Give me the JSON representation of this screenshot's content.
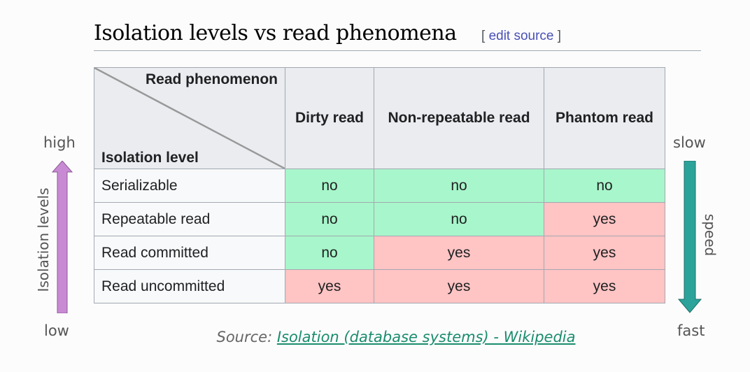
{
  "heading": {
    "title": "Isolation levels vs read phenomena",
    "edit_open": "[ ",
    "edit_link": "edit source",
    "edit_close": " ]"
  },
  "table": {
    "corner_top": "Read phenomenon",
    "corner_bottom": "Isolation level",
    "columns": [
      "Dirty read",
      "Non-repeatable read",
      "Phantom read"
    ],
    "rows": [
      {
        "label": "Serializable",
        "cells": [
          "no",
          "no",
          "no"
        ]
      },
      {
        "label": "Repeatable read",
        "cells": [
          "no",
          "no",
          "yes"
        ]
      },
      {
        "label": "Read committed",
        "cells": [
          "no",
          "yes",
          "yes"
        ]
      },
      {
        "label": "Read uncommitted",
        "cells": [
          "yes",
          "yes",
          "yes"
        ]
      }
    ]
  },
  "left_axis": {
    "high": "high",
    "low": "low",
    "label": "Isolation levels",
    "color": "#c98ad4"
  },
  "right_axis": {
    "top": "slow",
    "bottom": "fast",
    "label": "speed",
    "color": "#2ba39a"
  },
  "source": {
    "prefix": "Source: ",
    "link": "Isolation (database systems) - Wikipedia"
  },
  "colors": {
    "no": "#a8f6cb",
    "yes": "#ffc4c4"
  }
}
